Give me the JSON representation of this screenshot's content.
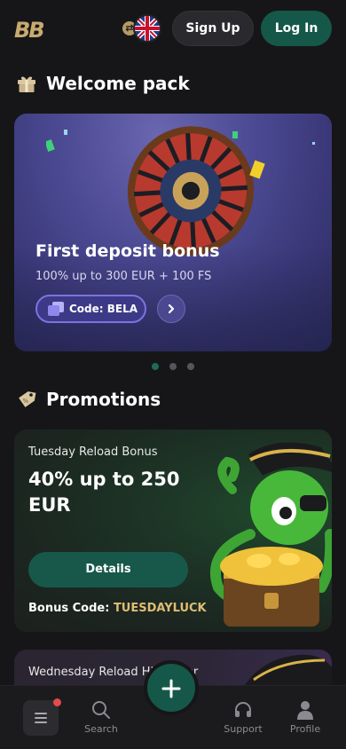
{
  "header": {
    "logo_text": "BB",
    "signup_label": "Sign Up",
    "login_label": "Log In",
    "language_icon": "uk-flag-icon",
    "swap_icon": "currency-swap-icon"
  },
  "welcome": {
    "section_title": "Welcome pack",
    "section_icon": "gift-icon",
    "card": {
      "title": "First deposit bonus",
      "subtitle": "100% up to 300 EUR + 100 FS",
      "code_label": "Code: BELA",
      "arrow_icon": "chevron-right-icon"
    },
    "carousel": {
      "count": 3,
      "active_index": 0
    }
  },
  "promotions": {
    "section_title": "Promotions",
    "section_icon": "tag-icon",
    "cards": [
      {
        "subtitle": "Tuesday Reload Bonus",
        "title": "40% up to 250 EUR",
        "button_label": "Details",
        "code_prefix": "Bonus Code: ",
        "code_value": "TUESDAYLUCK"
      },
      {
        "subtitle": "Wednesday Reload Highroller"
      }
    ]
  },
  "bottom_nav": {
    "items": [
      {
        "label": "",
        "icon": "menu-icon"
      },
      {
        "label": "Search",
        "icon": "search-icon"
      },
      {
        "label": "",
        "icon": "plus-icon"
      },
      {
        "label": "Support",
        "icon": "headset-icon"
      },
      {
        "label": "Profile",
        "icon": "user-icon"
      }
    ]
  },
  "colors": {
    "background": "#161618",
    "brand_green": "#15584a",
    "gold": "#c8aa6e",
    "code_accent": "#e0bd72",
    "welcome_purple": "#4b4992",
    "badge_red": "#e44b4b"
  }
}
